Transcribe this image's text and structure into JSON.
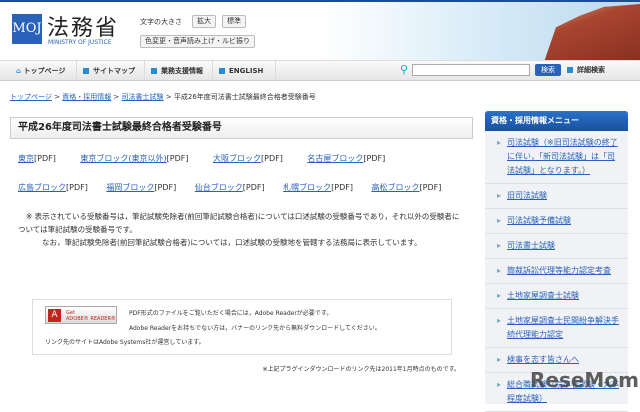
{
  "header": {
    "logo_mark": "MOJ",
    "logo_ja": "法務省",
    "logo_en": "MINISTRY OF JUSTICE",
    "font_size_label": "文字の大きさ",
    "enlarge": "拡大",
    "standard": "標準",
    "accessibility": "色変更・音声読み上げ・ルビ振り"
  },
  "nav": {
    "items": [
      "トップページ",
      "サイトマップ",
      "業務支援情報",
      "ENGLISH"
    ],
    "search_button": "検索",
    "advanced_search": "詳細検索"
  },
  "breadcrumb": [
    "トップページ",
    "資格・採用情報",
    "司法書士試験",
    "平成26年度司法書士試験最終合格者受験番号"
  ],
  "main": {
    "title": "平成26年度司法書士試験最終合格者受験番号",
    "pdf_suffix": "[PDF]",
    "row1": [
      "東京",
      "東京ブロック(東京以外)",
      "大阪ブロック",
      "名古屋ブロック"
    ],
    "row2": [
      "広島ブロック",
      "福岡ブロック",
      "仙台ブロック",
      "札幌ブロック",
      "高松ブロック"
    ],
    "note1": "※ 表示されている受験番号は，筆記試験免除者(前回筆記試験合格者)については口述試験の受験番号であり，それ以外の受験者については筆記試験の受験番号です。",
    "note2": "なお，筆記試験免除者(前回筆記試験合格者)については，口述試験の受験地を管轄する法務局に表示しています。"
  },
  "adobe": {
    "badge_get": "Get",
    "badge_name": "ADOBE® READER®",
    "line1": "PDF形式のファイルをご覧いただく場合には，Adobe Readerが必要です。",
    "line2": "Adobe Readerをお持ちでない方は，バナーのリンク先から無料ダウンロードしてください。",
    "line3": "リンク先のサイトはAdobe Systems社が運営しています。"
  },
  "footnote": "※上記プラグインダウンロードのリンク先は2011年1月時点のものです。",
  "sidebar": {
    "title": "資格・採用情報メニュー",
    "items": [
      "司法試験（※旧司法試験の終了に伴い，「新司法試験」は「司法試験」となります。）",
      "旧司法試験",
      "司法試験予備試験",
      "司法書士試験",
      "簡裁訴訟代理等能力認定考査",
      "土地家屋調査士試験",
      "土地家屋調査士民間紛争解決手続代理能力認定",
      "検事を志す皆さんへ",
      "総合職試験（院卒者試験・大卒程度試験）"
    ]
  },
  "watermark": "ReseMom"
}
